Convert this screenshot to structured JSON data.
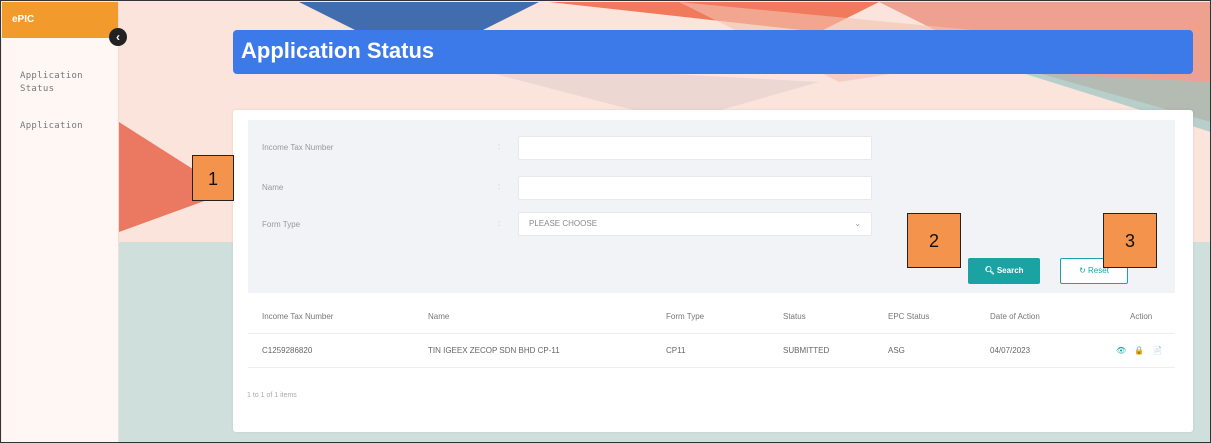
{
  "sidebar": {
    "brand": "ePIC",
    "items": [
      {
        "label": "Application Status"
      },
      {
        "label": "Application"
      }
    ],
    "collapse_icon": "chevron-left-icon"
  },
  "header": {
    "title": "Application Status"
  },
  "filters": {
    "fields": [
      {
        "label": "Income Tax Number",
        "value": ""
      },
      {
        "label": "Name",
        "value": ""
      },
      {
        "label": "Form Type",
        "value": "PLEASE CHOOSE"
      }
    ],
    "search_label": "Search",
    "reset_label": "Reset"
  },
  "table": {
    "columns": [
      "Income Tax Number",
      "Name",
      "Form Type",
      "Status",
      "EPC Status",
      "Date of Action",
      "Action"
    ],
    "rows": [
      {
        "tax_no": "C1259286820",
        "name": "TIN IGEEX ZECOP SDN BHD CP-11",
        "form": "CP11",
        "status": "SUBMITTED",
        "epc": "ASG",
        "date": "04/07/2023",
        "actions": "👁 🔒 📄"
      }
    ],
    "footer": "1 to 1 of 1 items"
  },
  "callouts": [
    "1",
    "2",
    "3"
  ],
  "colors": {
    "accent": "#3b7ae8",
    "primary_button": "#1ba3a3",
    "brand": "#f39a2d",
    "callout": "#f4934b"
  }
}
